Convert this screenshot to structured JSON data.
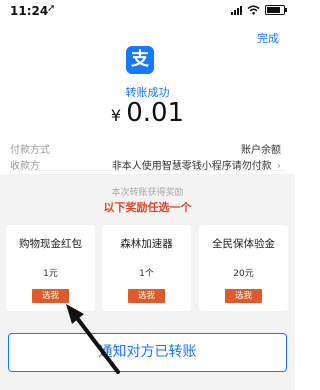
{
  "status_bar": {
    "time": "11:24",
    "location_glyph": "➚",
    "signal_icon": "signal-icon",
    "wifi_icon": "wifi-icon",
    "battery_icon": "battery-icon",
    "battery_level": 0.85
  },
  "header": {
    "done_label": "完成"
  },
  "transfer": {
    "logo_icon": "alipay-logo",
    "logo_char": "支",
    "status": "转账成功",
    "currency": "¥",
    "amount": "0.01"
  },
  "details": [
    {
      "label": "付款方式",
      "value": "账户余额"
    },
    {
      "label": "收款方",
      "value": "非本人使用智慧零钱小程序请勿付款",
      "chevron": "›"
    }
  ],
  "rewards": {
    "title": "本次转账获得奖励",
    "subtitle": "以下奖励任选一个",
    "cards": [
      {
        "name": "购物现金红包",
        "value": "1元",
        "button": "选我"
      },
      {
        "name": "森林加速器",
        "value": "1个",
        "button": "选我"
      },
      {
        "name": "全民保体验金",
        "value": "20元",
        "button": "选我"
      }
    ]
  },
  "notify_button": "通知对方已转账",
  "colors": {
    "accent": "#1677ff",
    "reward_red": "#e0452a",
    "button_orange": "#e0592a"
  }
}
